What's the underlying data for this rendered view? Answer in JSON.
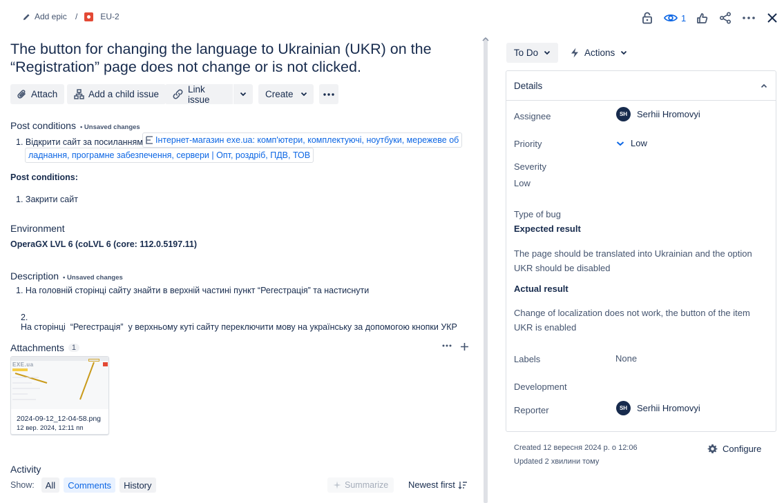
{
  "breadcrumb": {
    "add_epic": "Add epic",
    "separator": "/",
    "issue_key": "EU-2"
  },
  "top_actions": {
    "watch_count": "1"
  },
  "issue": {
    "title": "The button for changing the language to Ukrainian (UKR) on the “Registration” page does not change or is not clicked."
  },
  "toolbar": {
    "attach": "Attach",
    "add_child": "Add a child issue",
    "link_issue": "Link issue",
    "create": "Create"
  },
  "post_conditions_1": {
    "heading": "Post conditions",
    "unsaved": "• Unsaved changes",
    "item_num": "1.",
    "item_text": "Відкрити сайт за посиланням",
    "link_line1": "Інтернет-магазин exe.ua: комп'ютери, комплектуючі, ноутбуки, мережеве об",
    "link_line2": "ладнання, програмне забезпечення, сервери | Опт, роздріб, ПДВ, ТОВ"
  },
  "post_conditions_2": {
    "heading": "Post conditions:",
    "item_num": "1.",
    "item_text": "Закрити сайт"
  },
  "environment": {
    "heading": "Environment",
    "value": "OperaGX LVL 6 (coLVL 6 (core: 112.0.5197.11)"
  },
  "description": {
    "heading": "Description",
    "unsaved": "• Unsaved changes",
    "items": [
      {
        "num": "1.",
        "text": "На головній сторінці сайту знайти в верхній частині пункт “Регестрація” та настиснути"
      },
      {
        "num": "2.",
        "text": "На сторінці  “Регестрація”  у верхньому куті сайту переключити мову на українську за допомогою кнопки УКР"
      }
    ]
  },
  "attachments": {
    "heading": "Attachments",
    "count": "1",
    "file_name": "2024-09-12_12-04-58.png",
    "file_date": "12 вер. 2024, 12:11 пп",
    "thumb_logo": "EXE.ua"
  },
  "activity": {
    "heading": "Activity",
    "show_label": "Show:",
    "filters": [
      "All",
      "Comments",
      "History"
    ],
    "selected_filter": "Comments",
    "summarize": "Summarize",
    "sort": "Newest first"
  },
  "sidebar": {
    "status": "To Do",
    "actions": "Actions",
    "details_heading": "Details",
    "assignee_label": "Assignee",
    "assignee_initials": "SH",
    "assignee_name": "Serhii Hromovyi",
    "priority_label": "Priority",
    "priority_value": "Low",
    "severity_label": "Severity",
    "severity_value": "Low",
    "type_of_bug_label": "Type of bug",
    "expected_heading": "Expected result",
    "expected_line1": "The page should be translated into Ukrainian and the option",
    "expected_line2": "UKR should be disabled",
    "actual_heading": "Actual result",
    "actual_line1": "Change of localization does not work, the button of the item",
    "actual_line2": "UKR is enabled",
    "labels_label": "Labels",
    "labels_value": "None",
    "development_label": "Development",
    "reporter_label": "Reporter",
    "reporter_initials": "SH",
    "reporter_name": "Serhii Hromovyi",
    "created": "Created 12 вересня 2024 р. о 12:06",
    "updated": "Updated 2 хвилини тому",
    "configure": "Configure"
  },
  "colors": {
    "link": "#0c66e4",
    "text": "#172b4d",
    "muted": "#44546f",
    "bug": "#e34935"
  }
}
